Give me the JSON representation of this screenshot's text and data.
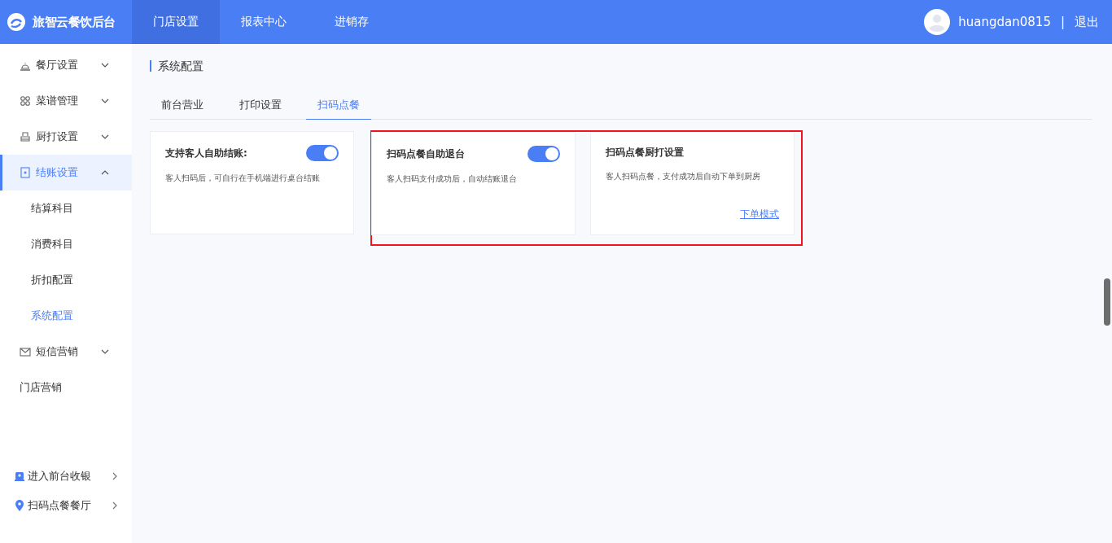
{
  "header": {
    "brand": "旅智云餐饮后台",
    "nav": [
      {
        "label": "门店设置",
        "selected": true
      },
      {
        "label": "报表中心",
        "selected": false
      },
      {
        "label": "进销存",
        "selected": false
      }
    ],
    "username": "huangdan0815",
    "separator": "|",
    "logout": "退出"
  },
  "sidebar": {
    "items": [
      {
        "kind": "group",
        "label": "餐厅设置",
        "expanded": false,
        "selected": false
      },
      {
        "kind": "group",
        "label": "菜谱管理",
        "expanded": false,
        "selected": false
      },
      {
        "kind": "group",
        "label": "厨打设置",
        "expanded": false,
        "selected": false
      },
      {
        "kind": "group",
        "label": "结账设置",
        "expanded": true,
        "selected": true,
        "children": [
          {
            "label": "结算科目",
            "selected": false
          },
          {
            "label": "消费科目",
            "selected": false
          },
          {
            "label": "折扣配置",
            "selected": false
          },
          {
            "label": "系统配置",
            "selected": true
          }
        ]
      },
      {
        "kind": "group",
        "label": "短信营销",
        "expanded": false,
        "selected": false
      },
      {
        "kind": "plain",
        "label": "门店营销",
        "selected": false
      }
    ],
    "bottom_links": [
      {
        "label": "进入前台收银"
      },
      {
        "label": "扫码点餐餐厅"
      }
    ]
  },
  "page_title": "系统配置",
  "tabs": [
    {
      "label": "前台营业",
      "selected": false
    },
    {
      "label": "打印设置",
      "selected": false
    },
    {
      "label": "扫码点餐",
      "selected": true
    }
  ],
  "cards": [
    {
      "title": "支持客人自助结账:",
      "highlighted": false,
      "on": true,
      "description": "客人扫码后，可自行在手机端进行桌台结账"
    },
    {
      "title": "扫码点餐自助退台",
      "highlighted": true,
      "on": true,
      "description": "客人扫码支付成功后，自动结账退台"
    },
    {
      "title": "扫码点餐厨打设置",
      "highlighted": true,
      "description": "客人扫码点餐，支付成功后自动下单到厨房",
      "link": "下单模式"
    }
  ]
}
